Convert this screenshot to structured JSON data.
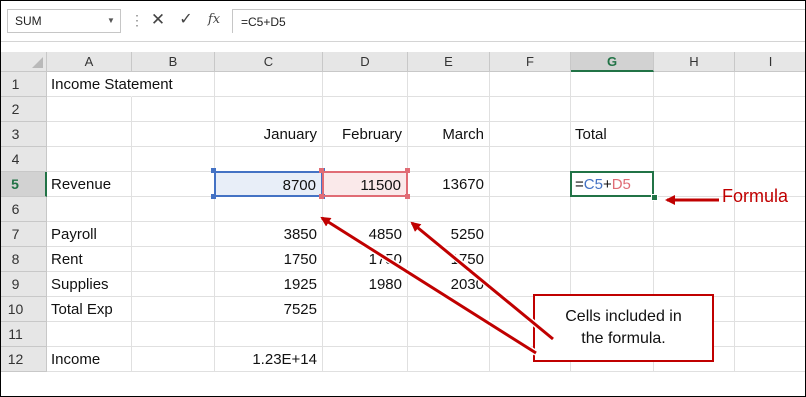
{
  "name_box": {
    "value": "SUM"
  },
  "formula_bar": {
    "cancel_icon": "close-icon",
    "enter_icon": "check-icon",
    "function_icon": "fx-icon",
    "fx_glyph": "fx",
    "value": "=C5+D5"
  },
  "columns": [
    "A",
    "B",
    "C",
    "D",
    "E",
    "F",
    "G",
    "H",
    "I"
  ],
  "selected_column": "G",
  "rows": [
    "1",
    "2",
    "3",
    "4",
    "5",
    "6",
    "7",
    "8",
    "9",
    "10",
    "11",
    "12"
  ],
  "selected_row": "5",
  "cells": {
    "A1": "Income Statement",
    "C3": "January",
    "D3": "February",
    "E3": "March",
    "G3": "Total",
    "A5": "Revenue",
    "C5": "8700",
    "D5": "11500",
    "E5": "13670",
    "A7": "Payroll",
    "C7": "3850",
    "D7": "4850",
    "E7": "5250",
    "A8": "Rent",
    "C8": "1750",
    "D8": "1750",
    "E8": "1750",
    "A9": "Supplies",
    "C9": "1925",
    "D9": "1980",
    "E9": "2030",
    "A10": "Total Exp",
    "C10": "7525",
    "A12": "Income",
    "C12": "1.23E+14"
  },
  "g5_formula": {
    "eq": "=",
    "ref1": "C5",
    "op": "+",
    "ref2": "D5"
  },
  "colors": {
    "ref1": "#4472c4",
    "ref2": "#e06c75",
    "active": "#217346",
    "annotation": "#c00000"
  },
  "annotations": {
    "formula_label": "Formula",
    "callout_line1": "Cells included in",
    "callout_line2": "the formula."
  }
}
